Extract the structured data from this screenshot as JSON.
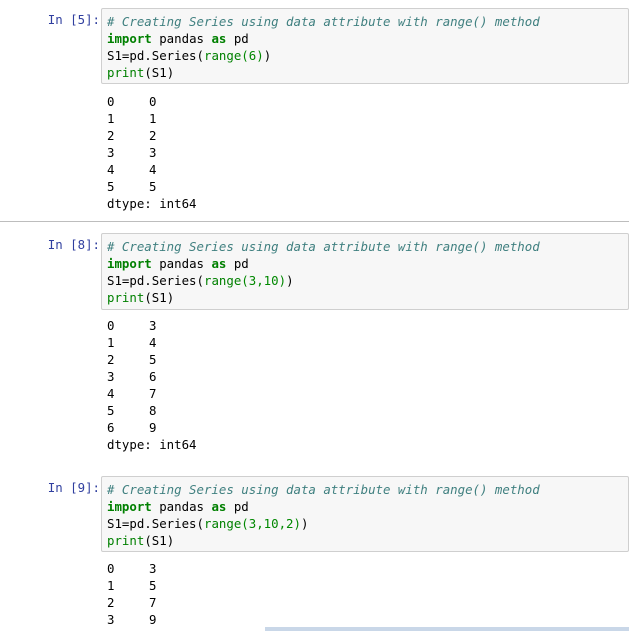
{
  "cells": [
    {
      "prompt": "In [5]:",
      "code": {
        "comment": "# Creating Series using data attribute with range() method",
        "import_kw": "import",
        "module": " pandas ",
        "as_kw": "as",
        "alias": " pd",
        "assign": "S1=pd.Series(",
        "range_fn": "range",
        "args": "(6)",
        "close": ")",
        "print_fn": "print",
        "print_args": "(S1)"
      },
      "output": [
        [
          "0",
          "0"
        ],
        [
          "1",
          "1"
        ],
        [
          "2",
          "2"
        ],
        [
          "3",
          "3"
        ],
        [
          "4",
          "4"
        ],
        [
          "5",
          "5"
        ]
      ],
      "dtype": "dtype: int64"
    },
    {
      "prompt": "In [8]:",
      "code": {
        "comment": "# Creating Series using data attribute with range() method",
        "import_kw": "import",
        "module": " pandas ",
        "as_kw": "as",
        "alias": " pd",
        "assign": "S1=pd.Series(",
        "range_fn": "range",
        "args": "(3,10)",
        "close": ")",
        "print_fn": "print",
        "print_args": "(S1)"
      },
      "output": [
        [
          "0",
          "3"
        ],
        [
          "1",
          "4"
        ],
        [
          "2",
          "5"
        ],
        [
          "3",
          "6"
        ],
        [
          "4",
          "7"
        ],
        [
          "5",
          "8"
        ],
        [
          "6",
          "9"
        ]
      ],
      "dtype": "dtype: int64"
    },
    {
      "prompt": "In [9]:",
      "code": {
        "comment": "# Creating Series using data attribute with range() method",
        "import_kw": "import",
        "module": " pandas ",
        "as_kw": "as",
        "alias": " pd",
        "assign": "S1=pd.Series(",
        "range_fn": "range",
        "args": "(3,10,2)",
        "close": ")",
        "print_fn": "print",
        "print_args": "(S1)"
      },
      "output": [
        [
          "0",
          "3"
        ],
        [
          "1",
          "5"
        ],
        [
          "2",
          "7"
        ],
        [
          "3",
          "9"
        ]
      ],
      "dtype": ""
    }
  ]
}
